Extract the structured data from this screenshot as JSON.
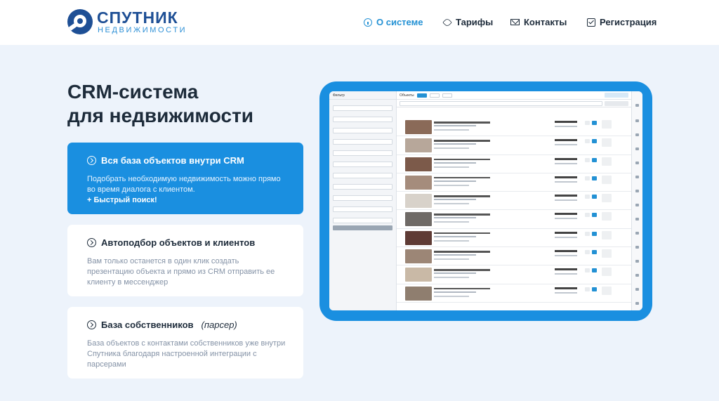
{
  "brand": {
    "name": "СПУТНИК",
    "subtitle": "НЕДВИЖИМОСТИ",
    "accent": "#1a8fe0",
    "dark": "#1e4f95"
  },
  "nav": [
    {
      "label": "О системе",
      "icon": "info-icon",
      "active": true
    },
    {
      "label": "Тарифы",
      "icon": "tag-icon",
      "active": false
    },
    {
      "label": "Контакты",
      "icon": "mail-icon",
      "active": false
    },
    {
      "label": "Регистрация",
      "icon": "checkbox-icon",
      "active": false
    }
  ],
  "hero": {
    "line1": "CRM-система",
    "line2": "для недвижимости"
  },
  "cards": [
    {
      "title": "Вся база объектов внутри CRM",
      "desc": "Подобрать необходимую недвижимость можно прямо во время диалога с клиентом.",
      "link": "+ Быстрый поиск!"
    },
    {
      "title": "Автоподбор объектов и клиентов",
      "desc": "Вам только останется в один клик создать презентацию объекта и прямо из CRM отправить ее клиенту в мессенджер"
    },
    {
      "title": "База собственников",
      "title_note": "(парсер)",
      "desc": "База объектов с контактами собственников уже внутри Спутника благодаря настроенной интеграции с парсерами"
    }
  ],
  "screenshot": {
    "filter_title": "Фильтр",
    "objects_title": "Объекты",
    "listing_prices": [
      "5 200 000 ₽",
      "5 200 000 ₽",
      "5 500 000 ₽",
      "5 150 000 ₽",
      "6 000 000 ₽",
      "2 900 000 ₽",
      "5 300 000 ₽",
      "3 700 000 ₽",
      "3 700 000 ₽",
      "3 550 000 ₽"
    ]
  }
}
